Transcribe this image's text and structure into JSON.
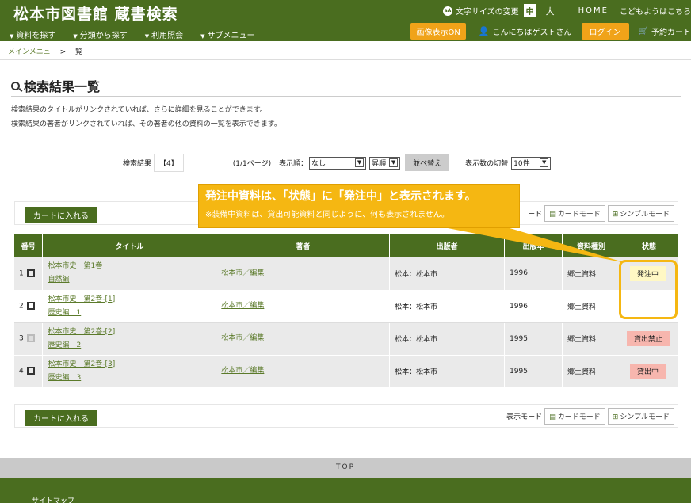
{
  "header": {
    "title": "松本市図書館 蔵書検索",
    "nav": [
      "資料を探す",
      "分類から探す",
      "利用照会",
      "サブメニュー"
    ],
    "font_size_label": "文字サイズの変更",
    "font_mid": "中",
    "font_big": "大",
    "home": "HOME",
    "kids": "こどもようはこちら",
    "image_toggle": "画像表示ON",
    "greeting": "こんにちはゲストさん",
    "login": "ログイン",
    "cart": "予約カート"
  },
  "breadcrumb": {
    "home": "メインメニュー",
    "sep": ">",
    "current": "一覧"
  },
  "page": {
    "title": "検索結果一覧",
    "desc1": "検索結果のタイトルがリンクされていれば、さらに詳細を見ることができます。",
    "desc2": "検索結果の著者がリンクされていれば、その著者の他の資料の一覧を表示できます。"
  },
  "controls": {
    "count_label": "検索結果",
    "count_value": "【4】",
    "pages": "(1/1ページ)",
    "order_label": "表示順：",
    "order_value": "なし",
    "dir_value": "昇順",
    "sort_button": "並べ替え",
    "per_page_label": "表示数の切替",
    "per_page_value": "10件"
  },
  "actions": {
    "cart_button": "カートに入れる",
    "mode_label": "表示モード",
    "mode_top_prefix": "ード",
    "card_mode": "カードモード",
    "simple_mode": "シンプルモード"
  },
  "table": {
    "headers": [
      "番号",
      "タイトル",
      "著者",
      "出版者",
      "出版年",
      "資料種別",
      "状態"
    ],
    "header_pub_year_partial": "出版年",
    "rows": [
      {
        "no": "1",
        "title1": "松本市史　第1巻",
        "title2": "自然編",
        "author": "松本市／編集",
        "publisher": "松本：松本市",
        "year": "1996",
        "type": "郷土資料",
        "status": "発注中"
      },
      {
        "no": "2",
        "title1": "松本市史　第2巻-[1]",
        "title2": "歴史編　1",
        "author": "松本市／編集",
        "publisher": "松本：松本市",
        "year": "1996",
        "type": "郷土資料",
        "status": ""
      },
      {
        "no": "3",
        "title1": "松本市史　第2巻-[2]",
        "title2": "歴史編　2",
        "author": "松本市／編集",
        "publisher": "松本：松本市",
        "year": "1995",
        "type": "郷土資料",
        "status": "貸出禁止"
      },
      {
        "no": "4",
        "title1": "松本市史　第2巻-[3]",
        "title2": "歴史編　3",
        "author": "松本市／編集",
        "publisher": "松本：松本市",
        "year": "1995",
        "type": "郷土資料",
        "status": "貸出中"
      }
    ]
  },
  "callout": {
    "line1": "発注中資料は、「状態」に「発注中」と表示されます。",
    "line2": "※装備中資料は、貸出可能資料と同じように、何も表示されません。"
  },
  "footer": {
    "top": "TOP",
    "sitemap": "サイトマップ"
  }
}
